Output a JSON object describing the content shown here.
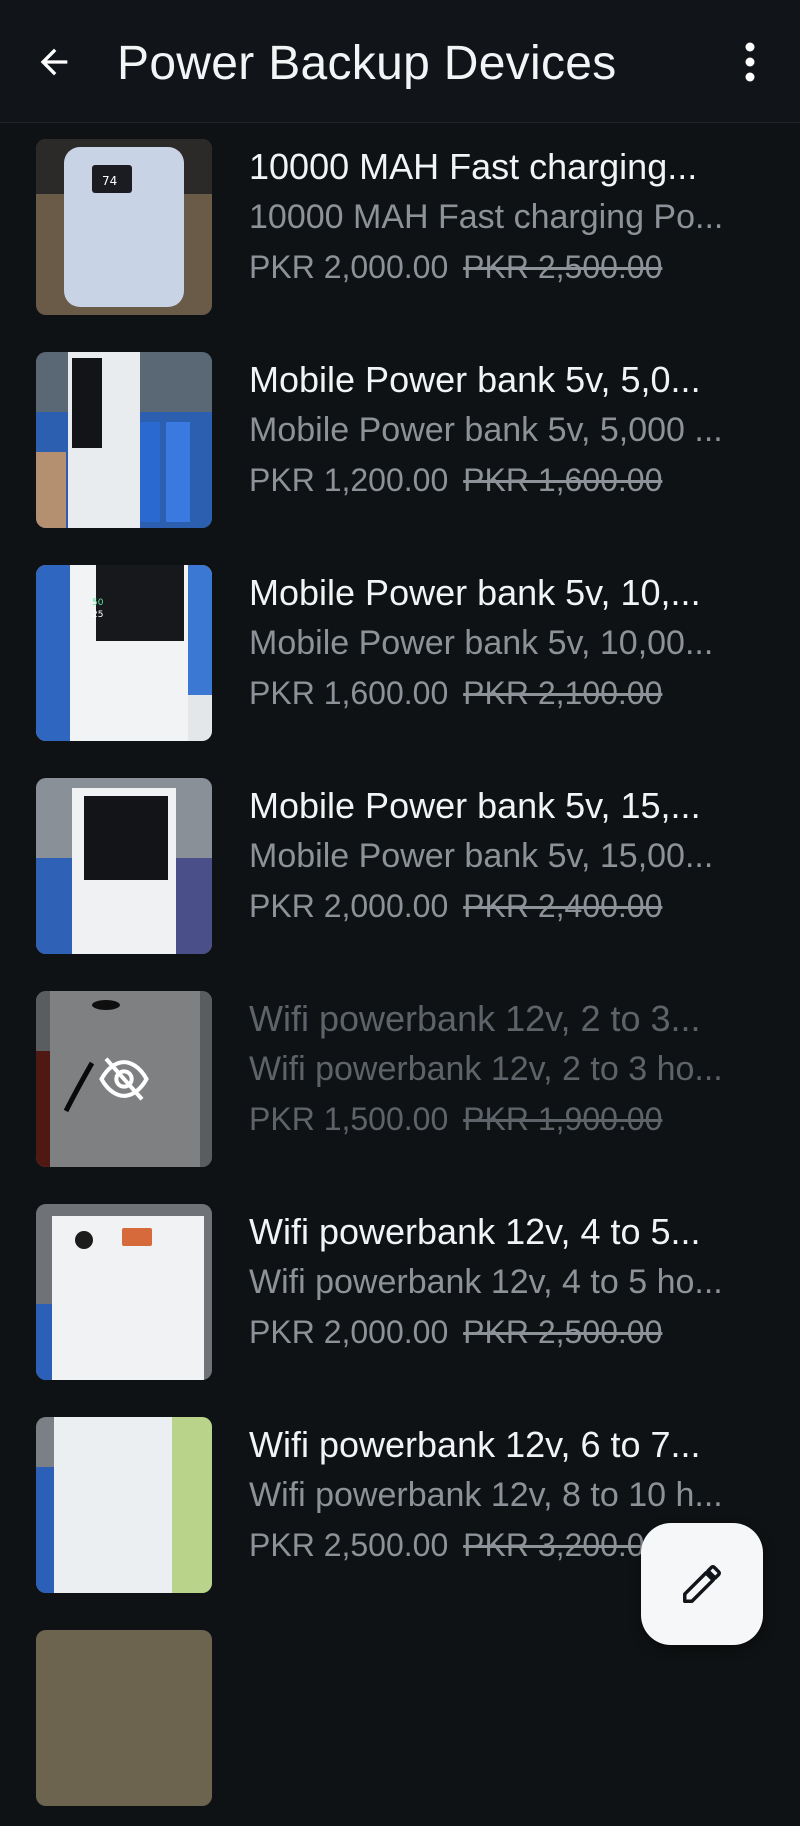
{
  "header": {
    "title": "Power Backup Devices",
    "back_icon": "arrow-left-icon",
    "menu_icon": "more-vertical-icon"
  },
  "items": [
    {
      "title": "10000 MAH Fast charging...",
      "subtitle": "10000 MAH Fast charging Po...",
      "price": "PKR 2,000.00",
      "old_price": "PKR 2,500.00"
    },
    {
      "title": "Mobile Power bank 5v, 5,0...",
      "subtitle": "Mobile Power bank 5v, 5,000 ...",
      "price": "PKR 1,200.00",
      "old_price": "PKR 1,600.00"
    },
    {
      "title": "Mobile Power bank 5v, 10,...",
      "subtitle": "Mobile Power bank 5v, 10,00...",
      "price": "PKR 1,600.00",
      "old_price": "PKR 2,100.00"
    },
    {
      "title": "Mobile Power bank 5v, 15,...",
      "subtitle": "Mobile Power bank 5v, 15,00...",
      "price": "PKR 2,000.00",
      "old_price": "PKR 2,400.00"
    },
    {
      "title": "Wifi powerbank 12v, 2 to 3...",
      "subtitle": "Wifi powerbank 12v, 2 to 3 ho...",
      "price": "PKR 1,500.00",
      "old_price": "PKR 1,900.00",
      "hidden_icon": "eye-off-icon"
    },
    {
      "title": "Wifi powerbank 12v, 4 to 5...",
      "subtitle": "Wifi powerbank 12v, 4 to 5 ho...",
      "price": "PKR 2,000.00",
      "old_price": "PKR 2,500.00"
    },
    {
      "title": "Wifi powerbank 12v, 6 to 7...",
      "subtitle": "Wifi powerbank 12v, 8 to 10 h...",
      "price": "PKR 2,500.00",
      "old_price": "PKR 3,200.00"
    }
  ],
  "fab": {
    "icon": "pencil-icon"
  },
  "colors": {
    "background": "#0f1214",
    "text_primary": "#f1f3f4",
    "text_secondary": "#8c9297",
    "fab_background": "#f6f7f8"
  }
}
